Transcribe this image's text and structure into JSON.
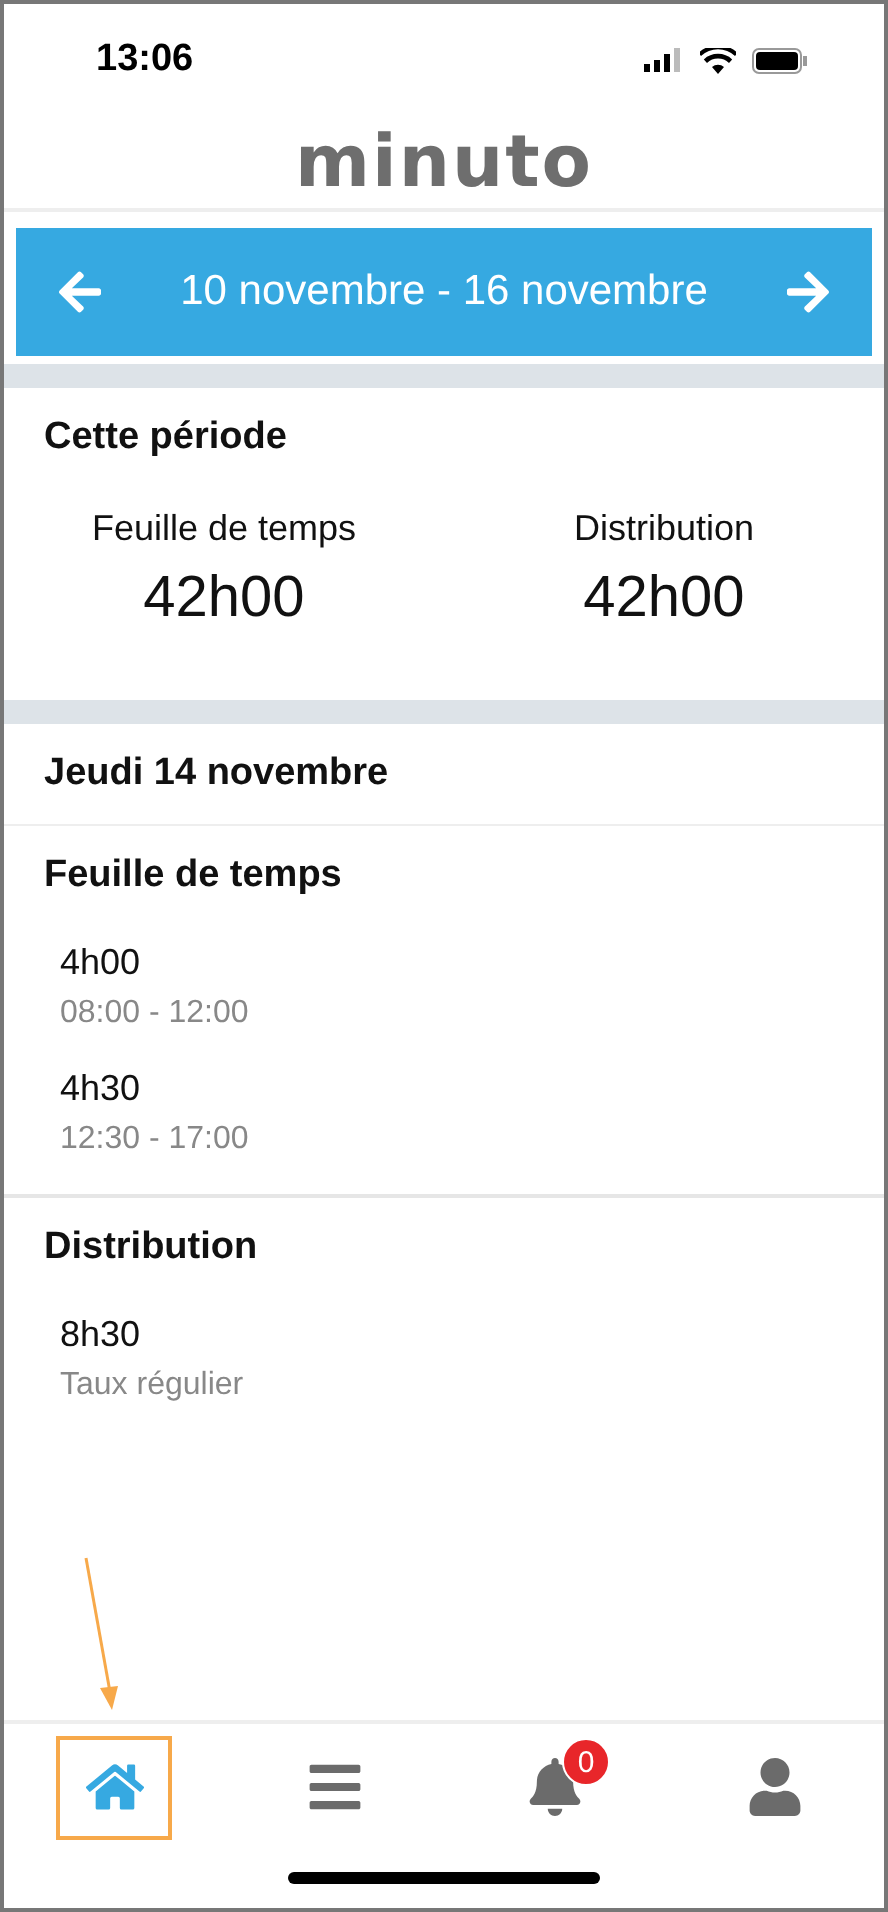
{
  "status_bar": {
    "time": "13:06"
  },
  "logo": "minuto",
  "period": {
    "label": "10 novembre - 16 novembre"
  },
  "summary": {
    "title": "Cette période",
    "stats": [
      {
        "label": "Feuille de temps",
        "value": "42h00"
      },
      {
        "label": "Distribution",
        "value": "42h00"
      }
    ]
  },
  "day": {
    "title": "Jeudi 14 novembre",
    "sections": [
      {
        "title": "Feuille de temps",
        "entries": [
          {
            "hours": "4h00",
            "detail": "08:00 - 12:00"
          },
          {
            "hours": "4h30",
            "detail": "12:30 - 17:00"
          }
        ]
      },
      {
        "title": "Distribution",
        "entries": [
          {
            "hours": "8h30",
            "detail": "Taux régulier"
          }
        ]
      }
    ]
  },
  "tab_bar": [
    {
      "kind": "home",
      "selected": true
    },
    {
      "kind": "menu",
      "selected": false
    },
    {
      "kind": "bell",
      "selected": false,
      "badge": "0"
    },
    {
      "kind": "user",
      "selected": false
    }
  ]
}
